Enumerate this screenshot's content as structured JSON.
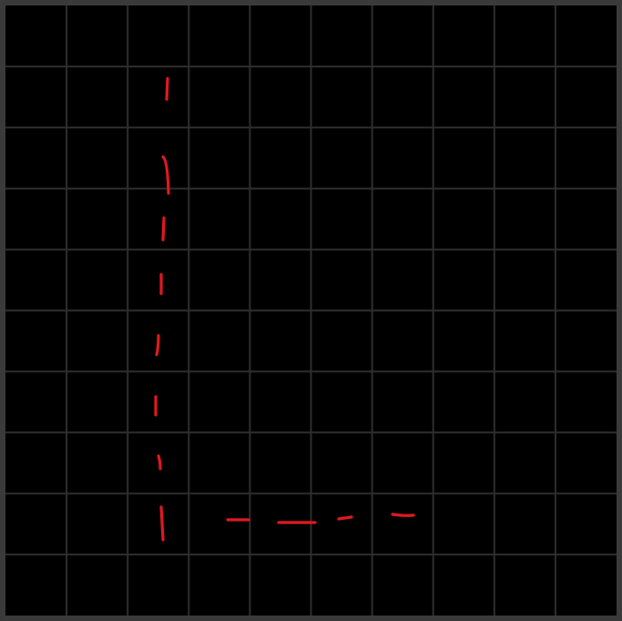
{
  "board": {
    "rows": 10,
    "cols": 10,
    "background_color": "#000000",
    "frame_color": "#3a3a3a",
    "grid_line_color": "#2e2e2e"
  },
  "stroke": {
    "color": "#e0191f",
    "style": "dashed hand-drawn L-shape"
  }
}
